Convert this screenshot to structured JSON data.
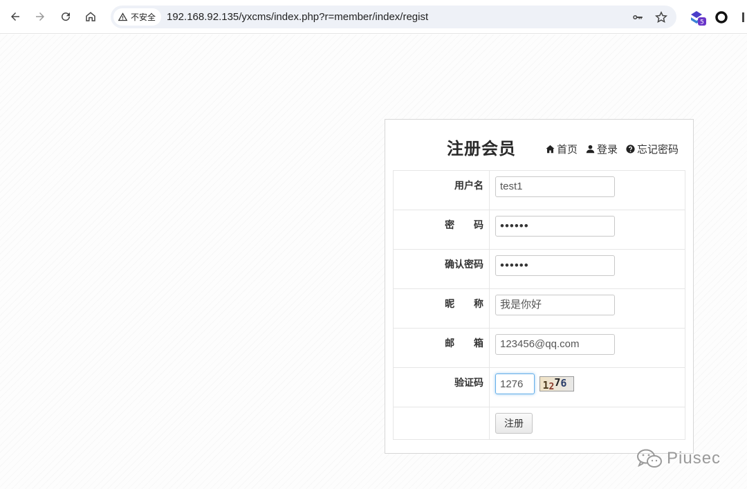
{
  "browser": {
    "security_label": "不安全",
    "url": "192.168.92.135/yxcms/index.php?r=member/index/regist",
    "extension_badge": "5"
  },
  "panel": {
    "title": "注册会员",
    "links": {
      "home": "首页",
      "login": "登录",
      "forgot": "忘记密码"
    }
  },
  "form": {
    "username": {
      "label": "用户名",
      "value": "test1"
    },
    "password": {
      "label": "密  码",
      "value": "••••••"
    },
    "confirm": {
      "label": "确认密码",
      "value": "••••••"
    },
    "nickname": {
      "label": "昵  称",
      "value": "我是你好"
    },
    "email": {
      "label": "邮  箱",
      "value": "123456@qq.com"
    },
    "captcha": {
      "label": "验证码",
      "value": "1276",
      "image_text": [
        "1",
        "2",
        "7",
        "6"
      ]
    },
    "submit_label": "注册"
  },
  "watermark": {
    "text": "Piusec"
  },
  "colors": {
    "focus_border": "#66afe9",
    "panel_border": "#d6d6d6",
    "omnibox_bg": "#eef1f7"
  }
}
